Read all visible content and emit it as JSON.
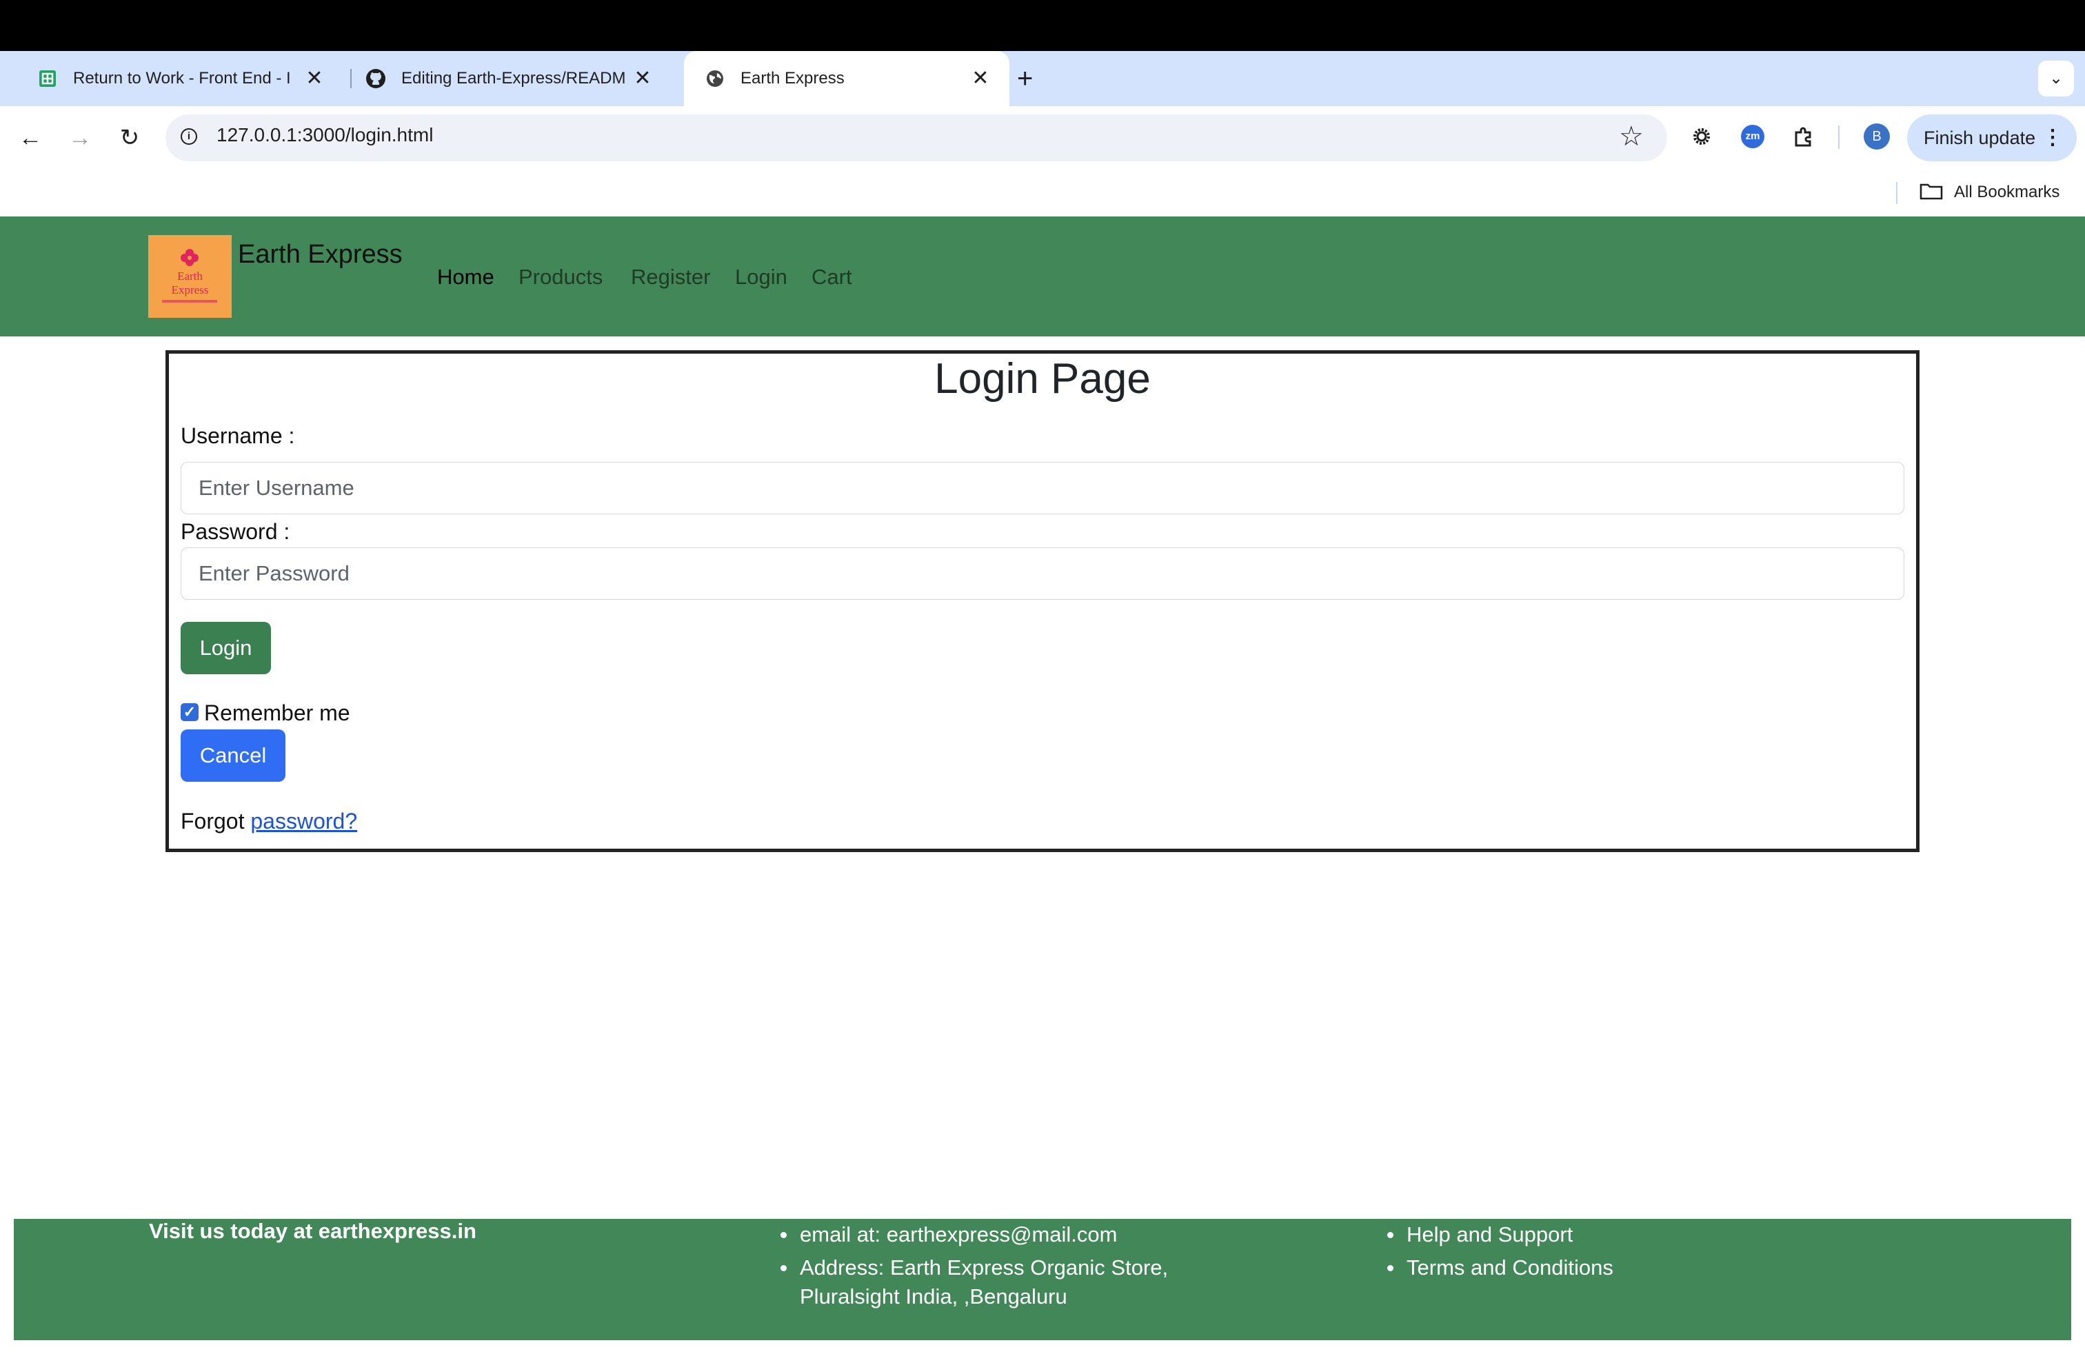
{
  "browser": {
    "tabs": [
      {
        "title": "Return to Work - Front End - I",
        "icon": "sheets-icon",
        "active": false
      },
      {
        "title": "Editing Earth-Express/READM",
        "icon": "github-icon",
        "active": false
      },
      {
        "title": "Earth Express",
        "icon": "globe-icon",
        "active": true
      }
    ],
    "url": "127.0.0.1:3000/login.html",
    "profile_initial": "B",
    "zoom_ext_label": "zm",
    "finish_update_label": "Finish update",
    "bookmarks_label": "All Bookmarks"
  },
  "site": {
    "brand": "Earth Express",
    "logo_line1": "Earth",
    "logo_line2": "Express",
    "nav": [
      "Home",
      "Products",
      "Register",
      "Login",
      "Cart"
    ]
  },
  "login": {
    "title": "Login Page",
    "username_label": "Username :",
    "username_placeholder": "Enter Username",
    "password_label": "Password :",
    "password_placeholder": "Enter Password",
    "login_button": "Login",
    "remember_label": "Remember me",
    "remember_checked": true,
    "cancel_button": "Cancel",
    "forgot_text": "Forgot",
    "forgot_link": "password?"
  },
  "footer": {
    "visit": "Visit us today at earthexpress.in",
    "contact": [
      "email at: earthexpress@mail.com",
      "Address: Earth Express Organic Store,"
    ],
    "contact_line2": "Pluralsight India, ,Bengaluru",
    "links": [
      "Help and Support",
      "Terms and Conditions"
    ]
  },
  "colors": {
    "nav_green": "#428757",
    "login_button": "#3b8050",
    "cancel_button": "#2f6df5",
    "link": "#1c53d6"
  }
}
